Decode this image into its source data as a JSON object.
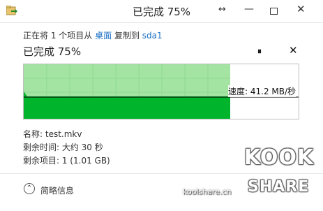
{
  "window": {
    "title": "已完成 75%",
    "resize_glyph": "↔",
    "minimize_glyph": "—",
    "close_glyph": "✕"
  },
  "copy": {
    "prefix": "正在将 1 个项目从",
    "source": "桌面",
    "middle": "复制到",
    "destination": "sda1",
    "percent_label": "已完成 75%",
    "progress_fraction": 0.75,
    "pause_glyph": "⏸",
    "cancel_glyph": "✕"
  },
  "speed_label": "速度: 41.2 MB/秒",
  "details": {
    "name": "名称: test.mkv",
    "time_left": "剩余时间: 大约 30 秒",
    "items_left": "剩余项目: 1 (1.01 GB)"
  },
  "footer": {
    "less_details": "简略信息",
    "chevron_glyph": "⌃"
  },
  "watermark": {
    "kook": "KOOK",
    "share": "SHARE",
    "url": "koolshare.cn"
  },
  "colors": {
    "progress_light": "#a3e4a3",
    "speed_fill": "#00b42b",
    "link": "#1a6fc4"
  }
}
